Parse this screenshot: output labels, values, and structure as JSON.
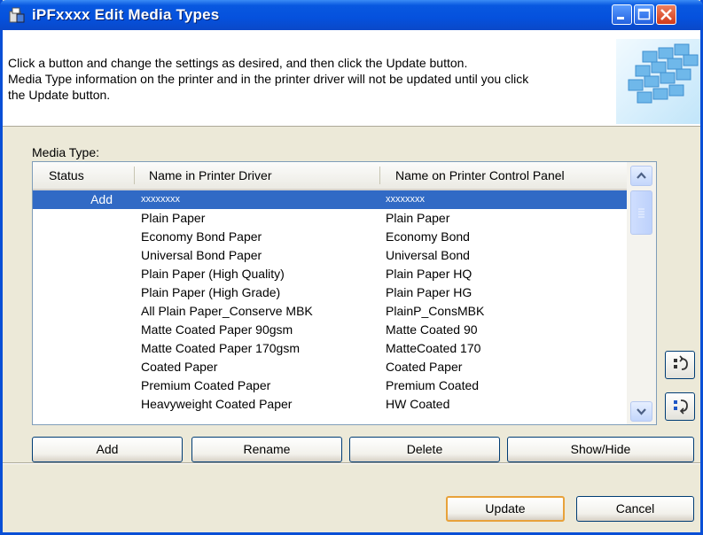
{
  "window": {
    "title": "iPFxxxx Edit Media Types"
  },
  "colors": {
    "titlebar": "#0551dd",
    "selection": "#316ac5",
    "default_button_border": "#e8a23a",
    "dialog_bg": "#ece9d8"
  },
  "icons": {
    "app": "media-types-icon",
    "minimize": "minimize-icon",
    "maximize": "maximize-icon",
    "close": "close-icon",
    "move_up": "move-up-icon",
    "move_down": "move-down-icon",
    "scroll_up": "scroll-up-arrow-icon",
    "scroll_down": "scroll-down-arrow-icon"
  },
  "header": {
    "line1": "Click a button and change the settings as desired, and then click the Update button.",
    "line2": "Media Type information on the printer and in the printer driver will not be updated until you click",
    "line3": "the Update button."
  },
  "media_type_label": "Media Type:",
  "columns": {
    "status": "Status",
    "driver": "Name in Printer Driver",
    "panel": "Name on Printer Control Panel"
  },
  "rows": [
    {
      "status": "Add",
      "driver": "xxxxxxxx",
      "panel": "xxxxxxxx"
    },
    {
      "status": "",
      "driver": "Plain Paper",
      "panel": "Plain Paper"
    },
    {
      "status": "",
      "driver": "Economy Bond Paper",
      "panel": "Economy Bond"
    },
    {
      "status": "",
      "driver": "Universal Bond Paper",
      "panel": "Universal Bond"
    },
    {
      "status": "",
      "driver": "Plain Paper (High Quality)",
      "panel": "Plain Paper HQ"
    },
    {
      "status": "",
      "driver": "Plain Paper (High Grade)",
      "panel": "Plain Paper HG"
    },
    {
      "status": "",
      "driver": "All Plain Paper_Conserve MBK",
      "panel": "PlainP_ConsMBK"
    },
    {
      "status": "",
      "driver": "Matte Coated Paper 90gsm",
      "panel": "Matte Coated 90"
    },
    {
      "status": "",
      "driver": "Matte Coated Paper 170gsm",
      "panel": "MatteCoated 170"
    },
    {
      "status": "",
      "driver": "Coated Paper",
      "panel": "Coated Paper"
    },
    {
      "status": "",
      "driver": "Premium Coated Paper",
      "panel": "Premium Coated"
    },
    {
      "status": "",
      "driver": "Heavyweight Coated Paper",
      "panel": "HW Coated"
    }
  ],
  "buttons": {
    "add": "Add",
    "rename": "Rename",
    "delete": "Delete",
    "show_hide": "Show/Hide",
    "update": "Update",
    "cancel": "Cancel"
  }
}
